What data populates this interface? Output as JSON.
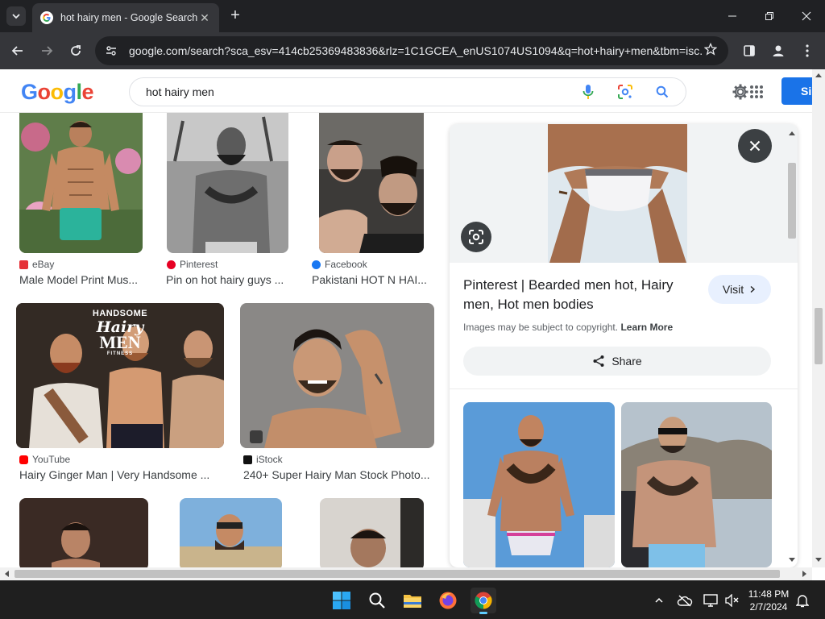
{
  "browser": {
    "tab_title": "hot hairy men - Google Search",
    "url": "google.com/search?sca_esv=414cb25369483836&rlz=1C1GCEA_enUS1074US1094&q=hot+hairy+men&tbm=isc..."
  },
  "google": {
    "logo": [
      "G",
      "o",
      "o",
      "g",
      "l",
      "e"
    ],
    "query": "hot hairy men",
    "signin_label": "Si"
  },
  "results": [
    {
      "source": "eBay",
      "title": "Male Model Print Mus..."
    },
    {
      "source": "Pinterest",
      "title": "Pin on hot hairy guys ..."
    },
    {
      "source": "Facebook",
      "title": "Pakistani HOT N HAI..."
    },
    {
      "source": "YouTube",
      "title": "Hairy Ginger Man | Very Handsome ...",
      "overlay": [
        "HANDSOME",
        "Hairy",
        "MEN",
        "FITNESS"
      ]
    },
    {
      "source": "iStock",
      "title": "240+ Super Hairy Man Stock Photo..."
    }
  ],
  "preview": {
    "title": "Pinterest | Bearded men hot, Hairy men, Hot men bodies",
    "visit_label": "Visit",
    "copyright_text": "Images may be subject to copyright.",
    "learn_more": "Learn More",
    "share_label": "Share"
  },
  "taskbar": {
    "time": "11:48 PM",
    "date": "2/7/2024"
  },
  "colors": {
    "google_blue": "#4285F4",
    "google_red": "#EA4335",
    "google_yellow": "#FBBC05",
    "google_green": "#34A853",
    "signin_blue": "#1a73e8",
    "tab_bar": "#202124",
    "toolbar": "#35363a"
  }
}
